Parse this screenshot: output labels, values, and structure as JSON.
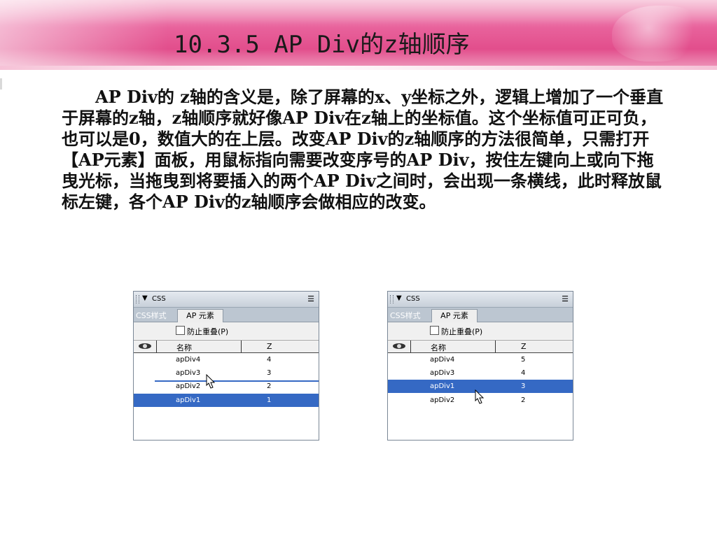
{
  "slide": {
    "title": "10.3.5  AP Div的z轴顺序",
    "body": "AP Div的 z轴的含义是，除了屏幕的x、y坐标之外，逻辑上增加了一个垂直于屏幕的z轴，z轴顺序就好像AP Div在z轴上的坐标值。这个坐标值可正可负，也可以是0，数值大的在上层。改变AP Div的z轴顺序的方法很简单，只需打开【AP元素】面板，用鼠标指向需要改变序号的AP Div，按住左键向上或向下拖曳光标，当拖曳到将要插入的两个AP Div之间时，会出现一条横线，此时释放鼠标左键，各个AP Div的z轴顺序会做相应的改变。"
  },
  "panels": [
    {
      "title": "CSS",
      "tabs": [
        "CSS样式",
        "AP 元素"
      ],
      "option_label": "防止重叠(P)",
      "columns": [
        "名称",
        "Z"
      ],
      "rows": [
        {
          "name": "apDiv4",
          "z": "4",
          "selected": false
        },
        {
          "name": "apDiv3",
          "z": "3",
          "selected": false
        },
        {
          "name": "apDiv2",
          "z": "2",
          "selected": false
        },
        {
          "name": "apDiv1",
          "z": "1",
          "selected": true
        }
      ],
      "icons": [
        "triangle-down-icon",
        "panel-menu-icon",
        "eye-icon",
        "cursor-icon"
      ]
    },
    {
      "title": "CSS",
      "tabs": [
        "CSS样式",
        "AP 元素"
      ],
      "option_label": "防止重叠(P)",
      "columns": [
        "名称",
        "Z"
      ],
      "rows": [
        {
          "name": "apDiv4",
          "z": "5",
          "selected": false
        },
        {
          "name": "apDiv3",
          "z": "4",
          "selected": false
        },
        {
          "name": "apDiv1",
          "z": "3",
          "selected": true
        },
        {
          "name": "apDiv2",
          "z": "2",
          "selected": false
        }
      ],
      "icons": [
        "triangle-down-icon",
        "panel-menu-icon",
        "eye-icon",
        "cursor-icon"
      ]
    }
  ],
  "colors": {
    "header_pink": "#e24e8c",
    "selection_blue": "#3569c4",
    "tab_bar": "#bcc6d1"
  }
}
